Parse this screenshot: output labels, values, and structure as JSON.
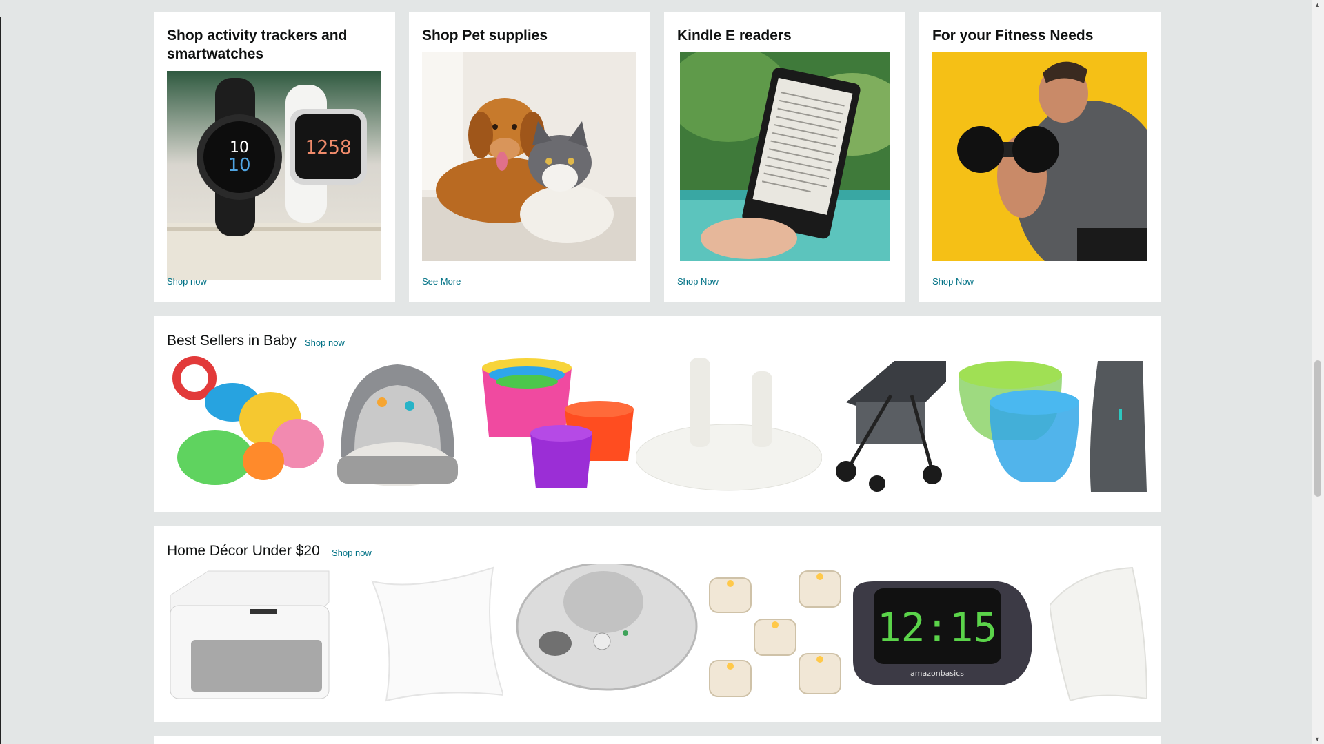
{
  "cards": [
    {
      "title": "Shop activity trackers and smartwatches",
      "link": "Shop now",
      "image": "smartwatches"
    },
    {
      "title": "Shop Pet supplies",
      "link": "See More",
      "image": "dog and cat"
    },
    {
      "title": "Kindle E readers",
      "link": "Shop Now",
      "image": "kindle reader"
    },
    {
      "title": "For your Fitness Needs",
      "link": "Shop Now",
      "image": "man with dumbbell"
    }
  ],
  "baby": {
    "title": "Best Sellers in Baby",
    "link": "Shop now",
    "items": [
      "teether keys",
      "baby play dome",
      "stacking cups",
      "outlet plug covers",
      "double stroller",
      "snack catcher cups",
      "baby carrier"
    ]
  },
  "decor": {
    "title": "Home Décor Under $20",
    "link": "Shop now",
    "items": [
      "white noise machine",
      "throw pillow insert",
      "sound machine",
      "flameless tea lights",
      "alarm clock",
      "pillow insert"
    ]
  },
  "clock_display": "12:15",
  "clock_brand": "amazonbasics",
  "colors": {
    "link": "#007185",
    "page_bg": "#e3e6e6",
    "card_bg": "#ffffff"
  }
}
